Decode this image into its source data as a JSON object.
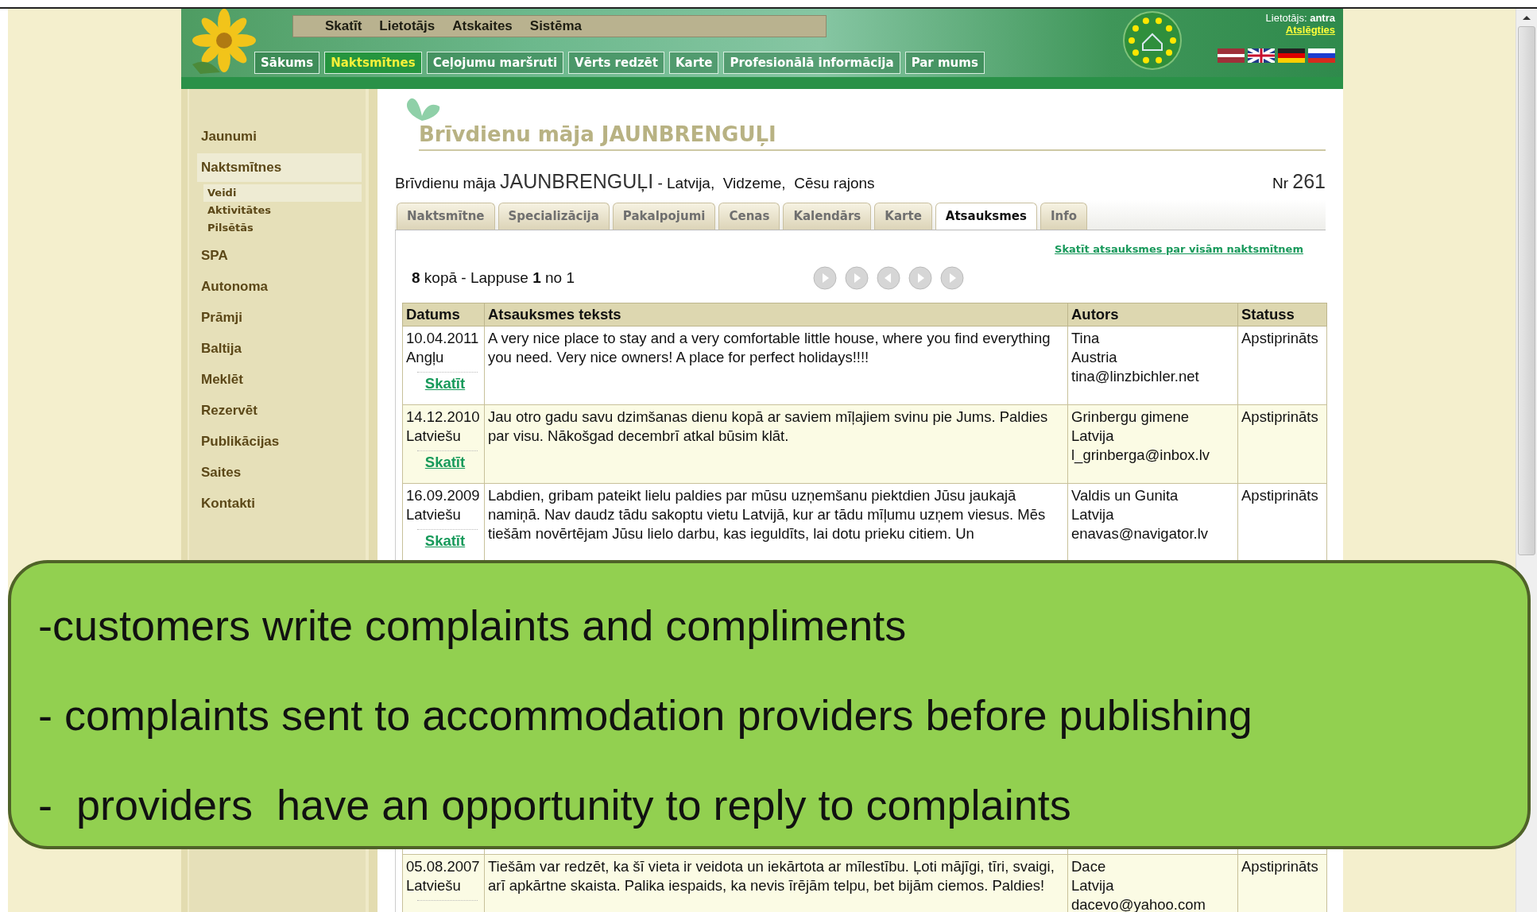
{
  "header": {
    "menu": [
      "Skatīt",
      "Lietotājs",
      "Atskaites",
      "Sistēma"
    ],
    "nav": [
      {
        "label": "Sākums",
        "selected": false
      },
      {
        "label": "Naktsmītnes",
        "selected": true
      },
      {
        "label": "Ceļojumu maršruti",
        "selected": false
      },
      {
        "label": "Vērts redzēt",
        "selected": false
      },
      {
        "label": "Karte",
        "selected": false
      },
      {
        "label": "Profesionālā informācija",
        "selected": false
      },
      {
        "label": "Par mums",
        "selected": false
      }
    ],
    "user": {
      "label": "Lietotājs:",
      "name": "antra",
      "logout": "Atslēgties"
    }
  },
  "sidebar": {
    "items": [
      {
        "label": "Jaunumi",
        "selected": false
      },
      {
        "label": "Naktsmītnes",
        "selected": true,
        "children": [
          {
            "label": "Veidi",
            "selected": true
          },
          {
            "label": "Aktivitātes",
            "selected": false
          },
          {
            "label": "Pilsētās",
            "selected": false
          }
        ]
      },
      {
        "label": "SPA",
        "selected": false
      },
      {
        "label": "Autonoma",
        "selected": false
      },
      {
        "label": "Prāmji",
        "selected": false
      },
      {
        "label": "Baltija",
        "selected": false
      },
      {
        "label": "Meklēt",
        "selected": false
      },
      {
        "label": "Rezervēt",
        "selected": false
      },
      {
        "label": "Publikācijas",
        "selected": false
      },
      {
        "label": "Saites",
        "selected": false
      },
      {
        "label": "Kontakti",
        "selected": false
      }
    ]
  },
  "page_title": "Brīvdienu māja JAUNBRENGUĻI",
  "subtitle": {
    "type": "Brīvdienu māja",
    "name": "JAUNBRENGUĻI",
    "location": "- Latvija,  Vidzeme,  Cēsu rajons",
    "nr_label": "Nr",
    "nr": "261"
  },
  "tabs": [
    {
      "label": "Naktsmītne",
      "selected": false
    },
    {
      "label": "Specializācija",
      "selected": false
    },
    {
      "label": "Pakalpojumi",
      "selected": false
    },
    {
      "label": "Cenas",
      "selected": false
    },
    {
      "label": "Kalendārs",
      "selected": false
    },
    {
      "label": "Karte",
      "selected": false
    },
    {
      "label": "Atsauksmes",
      "selected": true
    },
    {
      "label": "Info",
      "selected": false
    }
  ],
  "all_reviews_link": "Skatīt atsauksmes par visām naktsmītnem",
  "pager": {
    "summary": "**8** kopā - Lappuse **1** no 1"
  },
  "table": {
    "columns": [
      "Datums",
      "Atsauksmes teksts",
      "Autors",
      "Statuss"
    ],
    "rows": [
      {
        "date": "10.04.2011",
        "language": "Angļu",
        "link": "Skatīt",
        "text": "A very nice place to stay and a very comfortable little house, where you find everything you need. Very nice owners! A place for perfect holidays!!!!",
        "author": [
          "Tina",
          "Austria",
          "tina@linzbichler.net"
        ],
        "status": "Apstiprināts"
      },
      {
        "date": "14.12.2010",
        "language": "Latviešu",
        "link": "Skatīt",
        "text": "Jau otro gadu savu dzimšanas dienu kopā ar saviem mīļajiem svinu pie Jums. Paldies par visu. Nākošgad decembrī atkal būsim klāt.",
        "author": [
          "Grinbergu gimene",
          "Latvija",
          "l_grinberga@inbox.lv"
        ],
        "status": "Apstiprināts"
      },
      {
        "date": "16.09.2009",
        "language": "Latviešu",
        "link": "Skatīt",
        "text": "Labdien, gribam pateikt lielu paldies par mūsu uzņemšanu piektdien Jūsu jaukajā namiņā. Nav daudz tādu sakoptu vietu Latvijā, kur ar tādu mīļumu uzņem viesus. Mēs tiešām novērtējam Jūsu lielo darbu, kas ieguldīts, lai dotu prieku citiem. Un",
        "author": [
          "Valdis un Gunita",
          "Latvija",
          "enavas@navigator.lv"
        ],
        "status": "Apstiprināts"
      },
      {
        "date": "05.08.2007",
        "language": "Latviešu",
        "text": "Tiešām var redzēt, ka šī vieta ir veidota un iekārtota ar mīlestību. Ļoti mājīgi, tīri, svaigi, arī apkārtne skaista. Palika iespaids, ka nevis īrējām telpu, bet bijām ciemos. Paldies!",
        "author": [
          "Dace",
          "Latvija",
          "dacevo@yahoo.com"
        ],
        "status": "Apstiprināts"
      }
    ]
  },
  "callout": {
    "lines": [
      "-customers write complaints and compliments",
      "- complaints sent to accommodation providers before publishing",
      "-  providers  have an opportunity to reply to complaints"
    ]
  }
}
